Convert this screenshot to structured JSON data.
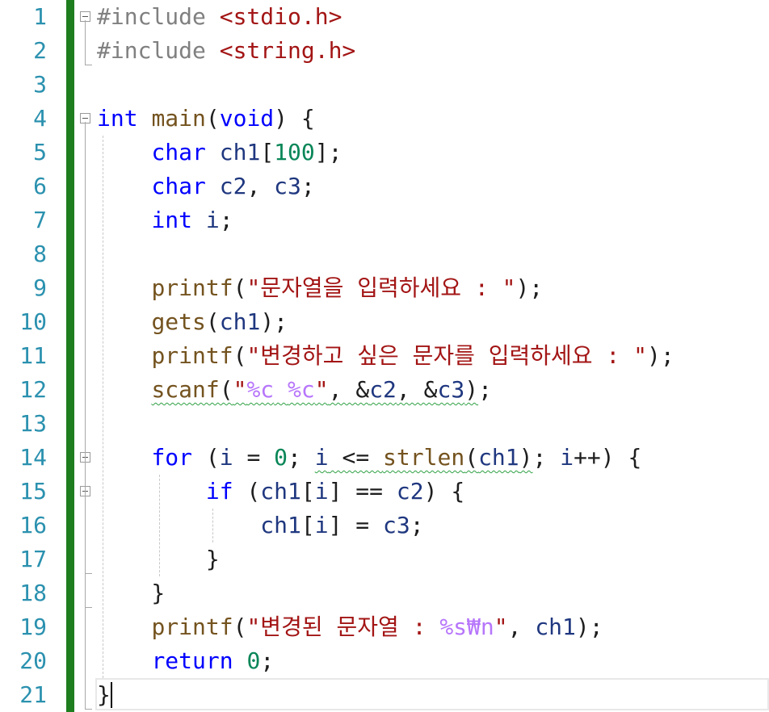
{
  "editor": {
    "line_numbers": [
      "1",
      "2",
      "3",
      "4",
      "5",
      "6",
      "7",
      "8",
      "9",
      "10",
      "11",
      "12",
      "13",
      "14",
      "15",
      "16",
      "17",
      "18",
      "19",
      "20",
      "21"
    ],
    "lines": [
      [
        {
          "t": "#include ",
          "c": "pp"
        },
        {
          "t": "<stdio.h>",
          "c": "str"
        }
      ],
      [
        {
          "t": "#include ",
          "c": "pp"
        },
        {
          "t": "<string.h>",
          "c": "str"
        }
      ],
      [],
      [
        {
          "t": "int",
          "c": "kw"
        },
        {
          "t": " "
        },
        {
          "t": "main",
          "c": "fn"
        },
        {
          "t": "("
        },
        {
          "t": "void",
          "c": "kw"
        },
        {
          "t": ") {"
        }
      ],
      [
        {
          "t": "    "
        },
        {
          "t": "char",
          "c": "kw"
        },
        {
          "t": " "
        },
        {
          "t": "ch1",
          "c": "var"
        },
        {
          "t": "["
        },
        {
          "t": "100",
          "c": "num"
        },
        {
          "t": "];"
        }
      ],
      [
        {
          "t": "    "
        },
        {
          "t": "char",
          "c": "kw"
        },
        {
          "t": " "
        },
        {
          "t": "c2",
          "c": "var"
        },
        {
          "t": ", "
        },
        {
          "t": "c3",
          "c": "var"
        },
        {
          "t": ";"
        }
      ],
      [
        {
          "t": "    "
        },
        {
          "t": "int",
          "c": "kw"
        },
        {
          "t": " "
        },
        {
          "t": "i",
          "c": "var"
        },
        {
          "t": ";"
        }
      ],
      [],
      [
        {
          "t": "    "
        },
        {
          "t": "printf",
          "c": "fn"
        },
        {
          "t": "("
        },
        {
          "t": "\"문자열을 입력하세요 : \"",
          "c": "str"
        },
        {
          "t": ");"
        }
      ],
      [
        {
          "t": "    "
        },
        {
          "t": "gets",
          "c": "fn"
        },
        {
          "t": "("
        },
        {
          "t": "ch1",
          "c": "var"
        },
        {
          "t": ");"
        }
      ],
      [
        {
          "t": "    "
        },
        {
          "t": "printf",
          "c": "fn"
        },
        {
          "t": "("
        },
        {
          "t": "\"변경하고 싶은 문자를 입력하세요 : \"",
          "c": "str"
        },
        {
          "t": ");"
        }
      ],
      [
        {
          "t": "    "
        },
        {
          "t": "scanf",
          "c": "fn",
          "sq": true
        },
        {
          "t": "(",
          "sq": true
        },
        {
          "t": "\"",
          "c": "str",
          "sq": true
        },
        {
          "t": "%c",
          "c": "fmt",
          "sq": true
        },
        {
          "t": " ",
          "c": "str",
          "sq": true
        },
        {
          "t": "%c",
          "c": "fmt",
          "sq": true
        },
        {
          "t": "\"",
          "c": "str",
          "sq": true
        },
        {
          "t": ", &",
          "sq": true
        },
        {
          "t": "c2",
          "c": "var",
          "sq": true
        },
        {
          "t": ", &",
          "sq": true
        },
        {
          "t": "c3",
          "c": "var",
          "sq": true
        },
        {
          "t": ")",
          "sq": true
        },
        {
          "t": ";"
        }
      ],
      [],
      [
        {
          "t": "    "
        },
        {
          "t": "for",
          "c": "kw"
        },
        {
          "t": " ("
        },
        {
          "t": "i",
          "c": "var"
        },
        {
          "t": " = "
        },
        {
          "t": "0",
          "c": "num"
        },
        {
          "t": "; "
        },
        {
          "t": "i",
          "c": "var",
          "sq": true
        },
        {
          "t": " <= ",
          "sq": true
        },
        {
          "t": "strlen",
          "c": "fn",
          "sq": true
        },
        {
          "t": "(",
          "sq": true
        },
        {
          "t": "ch1",
          "c": "var",
          "sq": true
        },
        {
          "t": ")",
          "sq": true
        },
        {
          "t": "; "
        },
        {
          "t": "i",
          "c": "var"
        },
        {
          "t": "++) {"
        }
      ],
      [
        {
          "t": "        "
        },
        {
          "t": "if",
          "c": "kw"
        },
        {
          "t": " ("
        },
        {
          "t": "ch1",
          "c": "var"
        },
        {
          "t": "["
        },
        {
          "t": "i",
          "c": "var"
        },
        {
          "t": "] == "
        },
        {
          "t": "c2",
          "c": "var"
        },
        {
          "t": ") {"
        }
      ],
      [
        {
          "t": "            "
        },
        {
          "t": "ch1",
          "c": "var"
        },
        {
          "t": "["
        },
        {
          "t": "i",
          "c": "var"
        },
        {
          "t": "] = "
        },
        {
          "t": "c3",
          "c": "var"
        },
        {
          "t": ";"
        }
      ],
      [
        {
          "t": "        }"
        }
      ],
      [
        {
          "t": "    }"
        }
      ],
      [
        {
          "t": "    "
        },
        {
          "t": "printf",
          "c": "fn"
        },
        {
          "t": "("
        },
        {
          "t": "\"변경된 문자열 : ",
          "c": "str"
        },
        {
          "t": "%s",
          "c": "fmt"
        },
        {
          "t": "₩n",
          "c": "esc"
        },
        {
          "t": "\"",
          "c": "str"
        },
        {
          "t": ", "
        },
        {
          "t": "ch1",
          "c": "var"
        },
        {
          "t": ");"
        }
      ],
      [
        {
          "t": "    "
        },
        {
          "t": "return",
          "c": "kw"
        },
        {
          "t": " "
        },
        {
          "t": "0",
          "c": "num"
        },
        {
          "t": ";"
        }
      ],
      [
        {
          "t": "}"
        }
      ]
    ],
    "icons": {
      "fold": "collapse-minus-icon"
    },
    "colors": {
      "line_number": "#2b91af",
      "change_bar": "#1e7d1e",
      "keyword": "#0000ff",
      "function": "#74531f",
      "string": "#a31515",
      "squiggle": "#2ea043"
    }
  }
}
